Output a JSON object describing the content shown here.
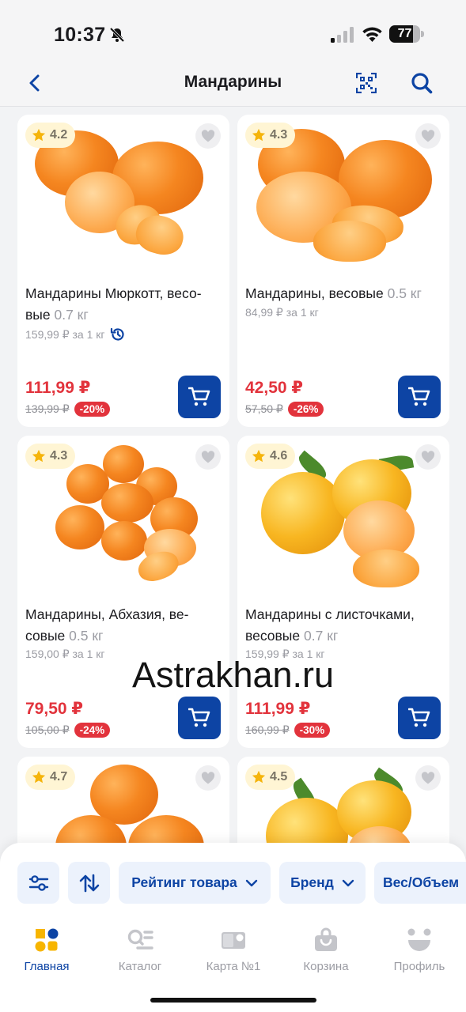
{
  "status_bar": {
    "time": "10:37",
    "battery": "77",
    "battery_level": 0.77
  },
  "header": {
    "title": "Мандарины",
    "back_icon": "chevron-left-icon",
    "qr_icon": "qr-code-icon",
    "search_icon": "search-icon"
  },
  "products": [
    {
      "rating": "4.2",
      "name": "Мандарины Мюркотт, весо-вые",
      "weight": "0.7 кг",
      "unit_price": "159,99 ₽ за 1 кг",
      "has_history_icon": true,
      "price": "111,99 ₽",
      "old_price": "139,99 ₽",
      "discount": "-20%"
    },
    {
      "rating": "4.3",
      "name": "Мандарины, весовые",
      "weight": "0.5 кг",
      "unit_price": "84,99 ₽ за 1 кг",
      "price": "42,50 ₽",
      "old_price": "57,50 ₽",
      "discount": "-26%"
    },
    {
      "rating": "4.3",
      "name": "Мандарины, Абхазия, ве-совые",
      "weight": "0.5 кг",
      "unit_price": "159,00 ₽ за 1 кг",
      "price": "79,50 ₽",
      "old_price": "105,00 ₽",
      "discount": "-24%"
    },
    {
      "rating": "4.6",
      "name": "Мандарины с листочками, весовые",
      "weight": "0.7 кг",
      "unit_price": "159,99 ₽ за 1 кг",
      "price": "111,99 ₽",
      "old_price": "160,99 ₽",
      "discount": "-30%"
    },
    {
      "rating": "4.7"
    },
    {
      "rating": "4.5"
    }
  ],
  "watermark": "Astrakhan.ru",
  "filters": {
    "settings_icon": "sliders-icon",
    "sort_icon": "sort-arrows-icon",
    "chips": [
      "Рейтинг товара",
      "Бренд",
      "Вес/Объем"
    ]
  },
  "tabbar": [
    {
      "label": "Главная",
      "icon": "home-tiles-icon",
      "active": true
    },
    {
      "label": "Каталог",
      "icon": "catalog-search-icon"
    },
    {
      "label": "Карта №1",
      "icon": "loyalty-card-icon"
    },
    {
      "label": "Корзина",
      "icon": "shopping-bag-icon"
    },
    {
      "label": "Профиль",
      "icon": "profile-smile-icon"
    }
  ],
  "colors": {
    "accent": "#0d44a4",
    "price_red": "#e2333c",
    "rating_bg": "#fff5d4",
    "star": "#f5b40b",
    "home_yellow": "#f7b500"
  }
}
